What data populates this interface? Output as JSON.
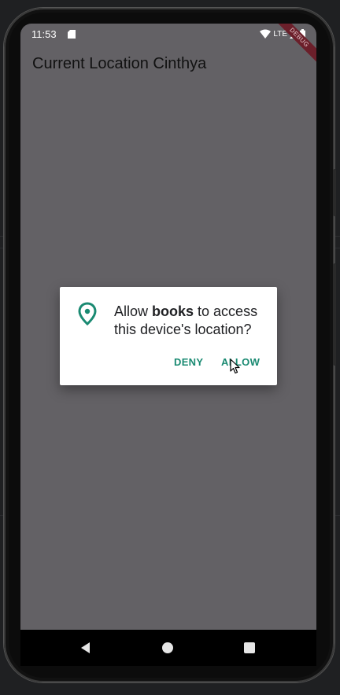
{
  "status_bar": {
    "time": "11:53",
    "network_label": "LTE",
    "debug_banner": "DEBUG"
  },
  "app": {
    "title": "Current Location Cinthya"
  },
  "permission_dialog": {
    "prefix": "Allow ",
    "app_name": "books",
    "suffix": " to access this device's location?",
    "deny_label": "DENY",
    "allow_label": "ALLOW",
    "accent_color": "#1a8a72"
  },
  "nav_bar": {
    "icons": [
      "back-icon",
      "home-icon",
      "recents-icon"
    ]
  }
}
